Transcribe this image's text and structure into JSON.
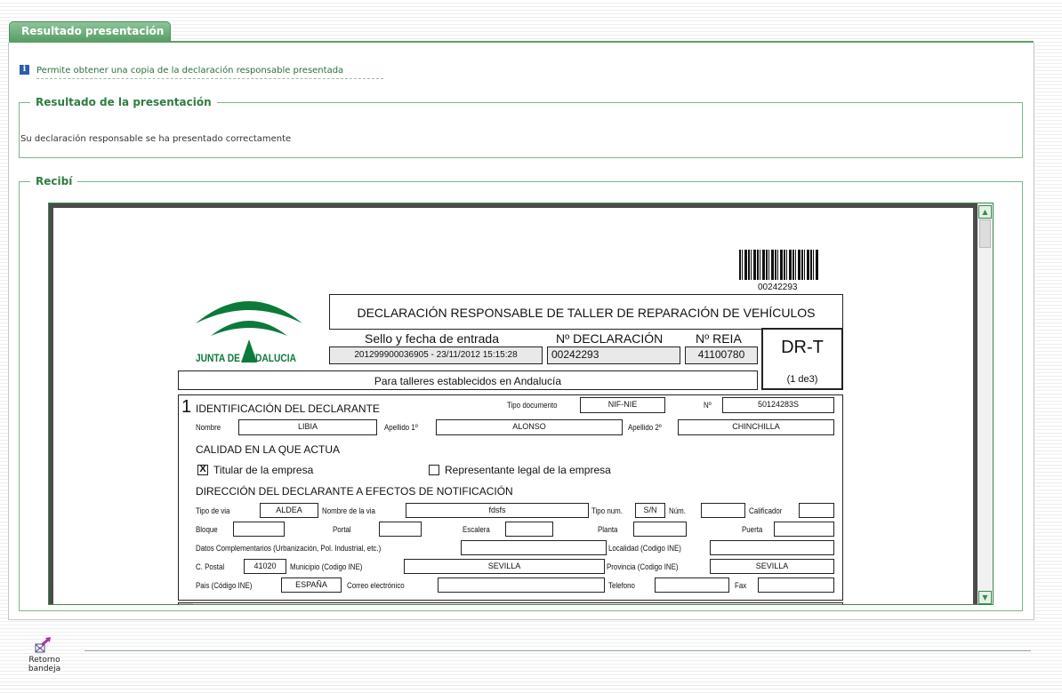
{
  "tab": {
    "label": "Resultado presentación"
  },
  "info": {
    "text": "Permite obtener una copia de la declaración responsable presentada"
  },
  "resultado": {
    "legend": "Resultado de la presentación",
    "message": "Su declaración responsable se ha presentado correctamente"
  },
  "recibi": {
    "legend": "Recibí"
  },
  "doc": {
    "barcode_number": "00242293",
    "title": "DECLARACIÓN RESPONSABLE DE TALLER DE REPARACIÓN DE VEHÍCULOS",
    "logo_text": "JUNTA DE ANDALUCIA",
    "sello_label": "Sello y fecha de entrada",
    "sello_value": "201299900036905 - 23/11/2012 15:15:28",
    "declaracion_label": "Nº DECLARACIÓN",
    "declaracion_value": "00242293",
    "reia_label": "Nº REIA",
    "reia_value": "41100780",
    "code": "DR-T",
    "page": "(1 de3)",
    "subtitle": "Para talleres establecidos en Andalucía",
    "section_num": "1",
    "section_title": "IDENTIFICACIÓN DEL DECLARANTE",
    "tipo_doc_label": "Tipo documento",
    "tipo_doc_value": "NIF-NIE",
    "num_label": "Nº",
    "num_value": "50124283S",
    "nombre_label": "Nombre",
    "nombre_value": "LIBIA",
    "apellido1_label": "Apellido 1º",
    "apellido1_value": "ALONSO",
    "apellido2_label": "Apellido 2º",
    "apellido2_value": "CHINCHILLA",
    "calidad_title": "CALIDAD EN LA QUE ACTUA",
    "titular_check": "X",
    "titular_label": "Titular de la empresa",
    "representante_label": "Representante legal de la empresa",
    "direccion_title": "DIRECCIÓN DEL DECLARANTE A EFECTOS DE NOTIFICACIÓN",
    "tipo_via_label": "Tipo de via",
    "tipo_via_value": "ALDEA",
    "nombre_via_label": "Nombre de la via",
    "nombre_via_value": "fdsfs",
    "tipo_num_label": "Tipo num.",
    "tipo_num_value": "S/N",
    "num2_label": "Núm.",
    "calificador_label": "Calificador",
    "bloque_label": "Bloque",
    "portal_label": "Portal",
    "escalera_label": "Escalera",
    "planta_label": "Planta",
    "puerta_label": "Puerta",
    "datos_comp_label": "Datos Complementarios (Urbanización, Pol. Industrial, etc.)",
    "localidad_label": "Localidad (Codigo INE)",
    "cpostal_label": "C. Postal",
    "cpostal_value": "41020",
    "municipio_label": "Municipio (Codigo INE)",
    "municipio_value": "SEVILLA",
    "provincia_label": "Provincia (Codigo INE)",
    "provincia_value": "SEVILLA",
    "pais_label": "Pais (Código INE)",
    "pais_value": "ESPAÑA",
    "correo_label": "Correo electrónico",
    "telefono_label": "Telefono",
    "fax_label": "Fax"
  },
  "footer": {
    "retorno_label": "Retorno bandeja"
  },
  "colors": {
    "accent": "#5a9e68",
    "link": "#2f6e3f"
  }
}
